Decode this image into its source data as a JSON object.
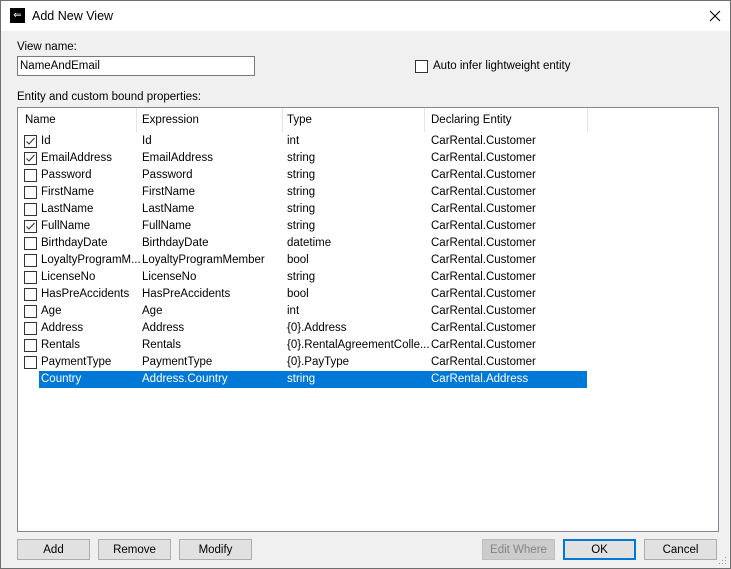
{
  "window": {
    "title": "Add New View",
    "app_icon": "arrow-back-icon",
    "close_icon": "close-icon"
  },
  "form": {
    "view_name_label": "View name:",
    "view_name_value": "NameAndEmail",
    "auto_infer_label": "Auto infer lightweight entity",
    "auto_infer_checked": false,
    "properties_label": "Entity and custom bound properties:"
  },
  "list": {
    "columns": [
      "Name",
      "Expression",
      "Type",
      "Declaring Entity"
    ],
    "rows": [
      {
        "checked": true,
        "name": "Id",
        "expression": "Id",
        "type": "int",
        "entity": "CarRental.Customer"
      },
      {
        "checked": true,
        "name": "EmailAddress",
        "expression": "EmailAddress",
        "type": "string",
        "entity": "CarRental.Customer"
      },
      {
        "checked": false,
        "name": "Password",
        "expression": "Password",
        "type": "string",
        "entity": "CarRental.Customer"
      },
      {
        "checked": false,
        "name": "FirstName",
        "expression": "FirstName",
        "type": "string",
        "entity": "CarRental.Customer"
      },
      {
        "checked": false,
        "name": "LastName",
        "expression": "LastName",
        "type": "string",
        "entity": "CarRental.Customer"
      },
      {
        "checked": true,
        "name": "FullName",
        "expression": "FullName",
        "type": "string",
        "entity": "CarRental.Customer"
      },
      {
        "checked": false,
        "name": "BirthdayDate",
        "expression": "BirthdayDate",
        "type": "datetime",
        "entity": "CarRental.Customer"
      },
      {
        "checked": false,
        "name": "LoyaltyProgramM...",
        "expression": "LoyaltyProgramMember",
        "type": "bool",
        "entity": "CarRental.Customer"
      },
      {
        "checked": false,
        "name": "LicenseNo",
        "expression": "LicenseNo",
        "type": "string",
        "entity": "CarRental.Customer"
      },
      {
        "checked": false,
        "name": "HasPreAccidents",
        "expression": "HasPreAccidents",
        "type": "bool",
        "entity": "CarRental.Customer"
      },
      {
        "checked": false,
        "name": "Age",
        "expression": "Age",
        "type": "int",
        "entity": "CarRental.Customer"
      },
      {
        "checked": false,
        "name": "Address",
        "expression": "Address",
        "type": "{0}.Address",
        "entity": "CarRental.Customer"
      },
      {
        "checked": false,
        "name": "Rentals",
        "expression": "Rentals",
        "type": "{0}.RentalAgreementColle...",
        "entity": "CarRental.Customer"
      },
      {
        "checked": false,
        "name": "PaymentType",
        "expression": "PaymentType",
        "type": "{0}.PayType",
        "entity": "CarRental.Customer"
      },
      {
        "checked": null,
        "name": "Country",
        "expression": "Address.Country",
        "type": "string",
        "entity": "CarRental.Address",
        "selected": true
      }
    ]
  },
  "buttons": {
    "add": "Add",
    "remove": "Remove",
    "modify": "Modify",
    "edit_where": "Edit Where",
    "ok": "OK",
    "cancel": "Cancel"
  },
  "colors": {
    "selection": "#0078d7",
    "dialog_bg": "#f0f0f0"
  }
}
